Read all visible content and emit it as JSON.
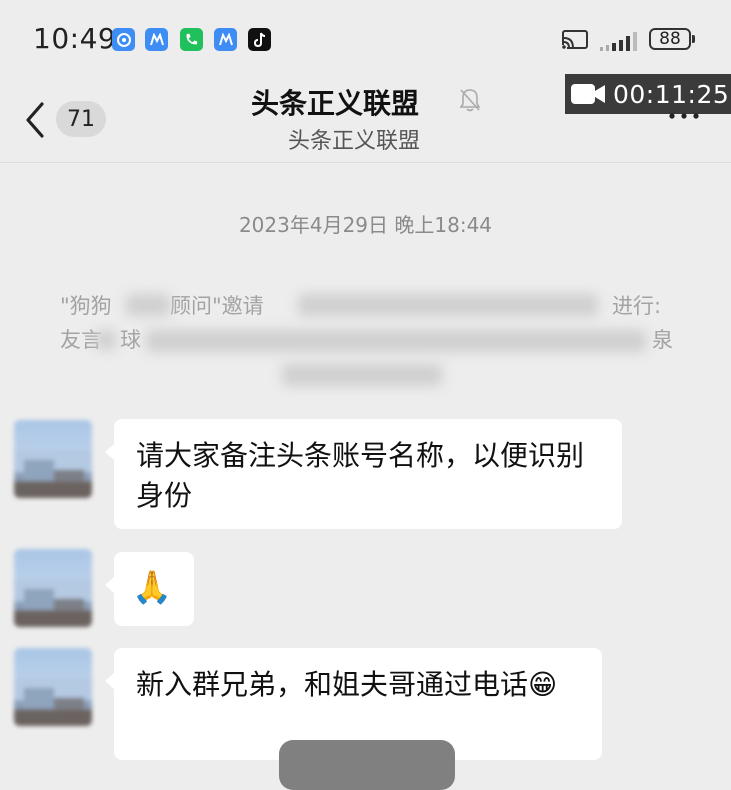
{
  "status_bar": {
    "time": "10:49",
    "battery": "88",
    "app_icons": [
      "browser-icon",
      "app-icon-blue",
      "phone-icon",
      "app-icon-blue",
      "tiktok-icon"
    ]
  },
  "recording": {
    "time": "00:11:25"
  },
  "header": {
    "back_count": "71",
    "title": "头条正义联盟",
    "subtitle": "头条正义联盟"
  },
  "chat": {
    "timestamp": "2023年4月29日 晚上18:44",
    "system_notice_visible": "\"狗狗",
    "system_notice_part2": "顾问\"邀请",
    "system_notice_part3": "进行:",
    "system_notice_line2_start": "友言",
    "system_notice_line2_mid": "球",
    "system_notice_line2_tail": "泉",
    "messages": [
      {
        "text": "请大家备注头条账号名称，以便识别身份"
      },
      {
        "text": "🙏"
      },
      {
        "text": "新入群兄弟，和姐夫哥通过电话😁"
      }
    ]
  },
  "colors": {
    "background": "#ededed",
    "bubble": "#ffffff",
    "recording_badge": "#3b3b3b",
    "accent_blue": "#3d8df5",
    "accent_green": "#20c05c"
  }
}
